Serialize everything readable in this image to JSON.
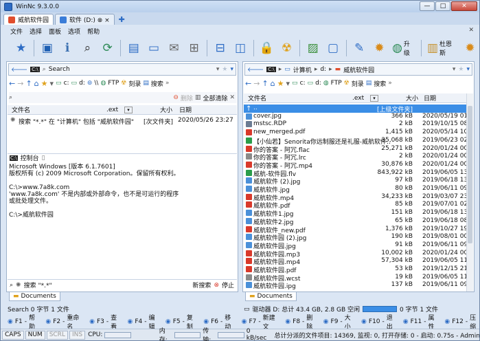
{
  "window": {
    "title": "WinNc 9.3.0.0",
    "min": "—",
    "max": "□",
    "close": "✕"
  },
  "tabs": [
    {
      "label": "威航软件园",
      "active": true
    },
    {
      "label": "软件 (D:) ⊗ ×",
      "active": false
    }
  ],
  "menu": [
    "文件",
    "选择",
    "面板",
    "选项",
    "帮助"
  ],
  "menu_right": "✕",
  "toolbar": {
    "upgrade_label": "升级",
    "dusj_label": "杜恩斯"
  },
  "left": {
    "address": "Search",
    "nav_ftp": "FTP",
    "nav_burn": "刻录",
    "nav_search": "搜索",
    "nav_c": "c:",
    "nav_d": "d:",
    "nav_net": "\\\\",
    "search_btn_del": "删除",
    "search_btn_clear": "全部清除",
    "headers": {
      "name": "文件名",
      "ext": ".ext",
      "size": "大小",
      "date": "日期"
    },
    "results": [
      {
        "name": "搜索 \"*.*\" 在 \"计算机\" 包括 \"威航软件园\"",
        "size": "[次文件夹]",
        "date": "2020/05/26 23:27"
      }
    ],
    "console_title": "控制台",
    "console_lines": [
      "Microsoft Windows [版本 6.1.7601]",
      "版权所有 (c) 2009 Microsoft Corporation。保留所有权利。",
      "",
      "C:\\>www.7a8k.com",
      "'www.7a8k.com' 不是内部或外部命令，也不是可运行的程序",
      "或批处理文件。",
      "",
      "C:\\>威航软件园"
    ],
    "search_footer": "搜索 \"*.*\"",
    "new_search": "新搜索",
    "stop": "停止",
    "doc_tab": "Documents",
    "status": "Search 0 字节 1 文件"
  },
  "right": {
    "address_parts": [
      "计算机",
      "d:",
      "威航软件园"
    ],
    "nav_ftp": "FTP",
    "nav_burn": "刻录",
    "nav_search": "搜索",
    "nav_c": "c:",
    "nav_d": "d:",
    "headers": {
      "name": "文件名",
      "ext": ".ext",
      "size": "大小",
      "date": "日期"
    },
    "files": [
      {
        "name": "..",
        "size": "[上级文件夹]",
        "date": "",
        "color": "#3b8ee6",
        "sel": true
      },
      {
        "name": "cover.jpg",
        "size": "366 kB",
        "date": "2020/05/19 01:02",
        "color": "#4a90d9"
      },
      {
        "name": "mstsc.RDP",
        "size": "2 kB",
        "date": "2019/10/15 08:24",
        "color": "#6b7c93"
      },
      {
        "name": "new_merged.pdf",
        "size": "1,415 kB",
        "date": "2020/05/14 10:39",
        "color": "#d9392b"
      },
      {
        "name": "【小仙若】Senorita你远制服还是礼服-威航软件...",
        "size": "35,068 kB",
        "date": "2019/06/23 02:19",
        "color": "#2a9d4a"
      },
      {
        "name": "你的答案 - 阿冗.flac",
        "size": "25,271 kB",
        "date": "2020/01/24 00:25",
        "color": "#d9392b"
      },
      {
        "name": "你的答案 - 阿冗.lrc",
        "size": "2 kB",
        "date": "2020/01/24 00:25",
        "color": "#8a8a8a"
      },
      {
        "name": "你的答案 - 阿冗.mp4",
        "size": "30,876 kB",
        "date": "2020/01/24 00:25",
        "color": "#d9392b"
      },
      {
        "name": "威航-软件园.flv",
        "size": "843,922 kB",
        "date": "2019/06/05 13:51",
        "color": "#2a9d4a"
      },
      {
        "name": "威航软件 (2).jpg",
        "size": "97 kB",
        "date": "2019/06/18 13:16",
        "color": "#4a90d9"
      },
      {
        "name": "威航软件.jpg",
        "size": "80 kB",
        "date": "2019/06/11 09:57",
        "color": "#4a90d9"
      },
      {
        "name": "威航软件.mp4",
        "size": "34,233 kB",
        "date": "2019/03/07 23:31",
        "color": "#d9392b"
      },
      {
        "name": "威航软件.pdf",
        "size": "85 kB",
        "date": "2019/07/01 02:04",
        "color": "#d9392b"
      },
      {
        "name": "威航软件1.jpg",
        "size": "151 kB",
        "date": "2019/06/18 13:16",
        "color": "#4a90d9"
      },
      {
        "name": "威航软件2.jpg",
        "size": "65 kB",
        "date": "2019/06/18 08:58",
        "color": "#4a90d9"
      },
      {
        "name": "威航软件_new.pdf",
        "size": "1,376 kB",
        "date": "2019/10/27 19:05",
        "color": "#d9392b"
      },
      {
        "name": "威航软件园 (2).jpg",
        "size": "190 kB",
        "date": "2019/08/01 00:22",
        "color": "#4a90d9"
      },
      {
        "name": "威航软件园.jpg",
        "size": "91 kB",
        "date": "2019/06/11 09:57",
        "color": "#4a90d9"
      },
      {
        "name": "威航软件园.mp3",
        "size": "10,002 kB",
        "date": "2020/01/24 00:27",
        "color": "#d9392b"
      },
      {
        "name": "威航软件园.mp4",
        "size": "57,304 kB",
        "date": "2019/06/05 11:28",
        "color": "#d9392b"
      },
      {
        "name": "威航软件园.pdf",
        "size": "53 kB",
        "date": "2019/12/15 21:36",
        "color": "#d9392b"
      },
      {
        "name": "威航软件园.wcst",
        "size": "19 kB",
        "date": "2019/06/05 11:15",
        "color": "#8a8a8a"
      },
      {
        "name": "威航软件园.ipg",
        "size": "137 kB",
        "date": "2019/06/11 09:57",
        "color": "#4a90d9"
      }
    ],
    "doc_tab": "Documents",
    "status_drive": "驱动器 D: 总计 43.4 GB, 2.8 GB 空闲",
    "status_files": "0 字节 1 文件"
  },
  "fkeys": [
    {
      "key": "F1",
      "label": "帮助"
    },
    {
      "key": "F2",
      "label": "重命名"
    },
    {
      "key": "F3",
      "label": "查看"
    },
    {
      "key": "F4",
      "label": "编辑"
    },
    {
      "key": "F5",
      "label": "复制"
    },
    {
      "key": "F6",
      "label": "移动"
    },
    {
      "key": "F7",
      "label": "新建文"
    },
    {
      "key": "F8",
      "label": "删除"
    },
    {
      "key": "F9",
      "label": "大小"
    },
    {
      "key": "F10",
      "label": "退出"
    },
    {
      "key": "F11",
      "label": "属性"
    },
    {
      "key": "F12",
      "label": "压缩"
    }
  ],
  "bottom": {
    "caps": "CAPS",
    "num": "NUM",
    "scrl": "SCRL",
    "ins": "INS",
    "cpu": "CPU:",
    "mem": "内存:",
    "net": "传输:",
    "net_val": "0 kB/sec",
    "summary": "总计分派的文件项目: 14369, 监视: 0, 打开存储: 0 - 启动: 0.75s - Administrato"
  }
}
